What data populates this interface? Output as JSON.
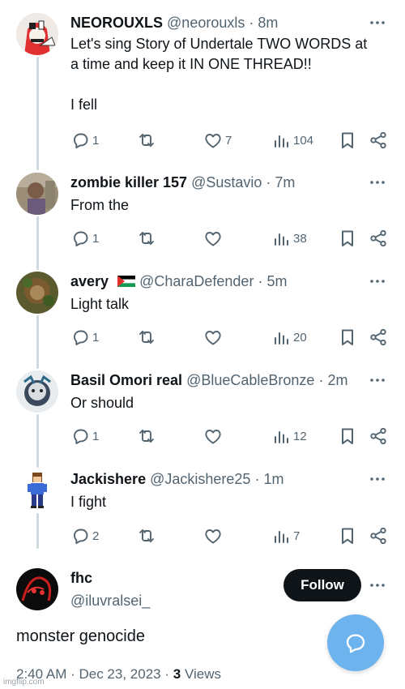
{
  "tweets": [
    {
      "name": "NEOROUXLS",
      "handle": "@neorouxls",
      "time": "· 8m",
      "text": "Let's sing Story of Undertale TWO WORDS at\na time and keep it IN ONE THREAD!!\n\nI fell",
      "replies": "1",
      "retweets": "",
      "likes": "7",
      "views": "104"
    },
    {
      "name": "zombie killer 157",
      "handle": "@Sustavio",
      "time": "· 7m",
      "text": "From the",
      "replies": "1",
      "retweets": "",
      "likes": "",
      "views": "38"
    },
    {
      "name": "avery",
      "handle": "@CharaDefender",
      "time": "· 5m",
      "text": "Light talk",
      "replies": "1",
      "retweets": "",
      "likes": "",
      "views": "20"
    },
    {
      "name": "Basil Omori real",
      "handle": "@BlueCableBronze",
      "time": "· 2m",
      "text": "Or should",
      "replies": "1",
      "retweets": "",
      "likes": "",
      "views": "12"
    },
    {
      "name": "Jackishere",
      "handle": "@Jackishere25",
      "time": "· 1m",
      "text": "I fight",
      "replies": "2",
      "retweets": "",
      "likes": "",
      "views": "7"
    }
  ],
  "focused": {
    "name": "fhc",
    "handle": "@iluvralsei_",
    "follow_label": "Follow",
    "text": "monster genocide",
    "timestamp": "2:40 AM · Dec 23, 2023 ·",
    "views_count": "3",
    "views_label": "Views"
  },
  "watermark": "imgflip.com",
  "colors": {
    "text": "#0f1419",
    "secondary": "#536471",
    "thread_line": "#cfd9de",
    "fab": "#6db3ee"
  },
  "icons": [
    "more-icon",
    "reply-icon",
    "retweet-icon",
    "like-icon",
    "views-icon",
    "bookmark-icon",
    "share-icon",
    "compose-message-icon"
  ]
}
